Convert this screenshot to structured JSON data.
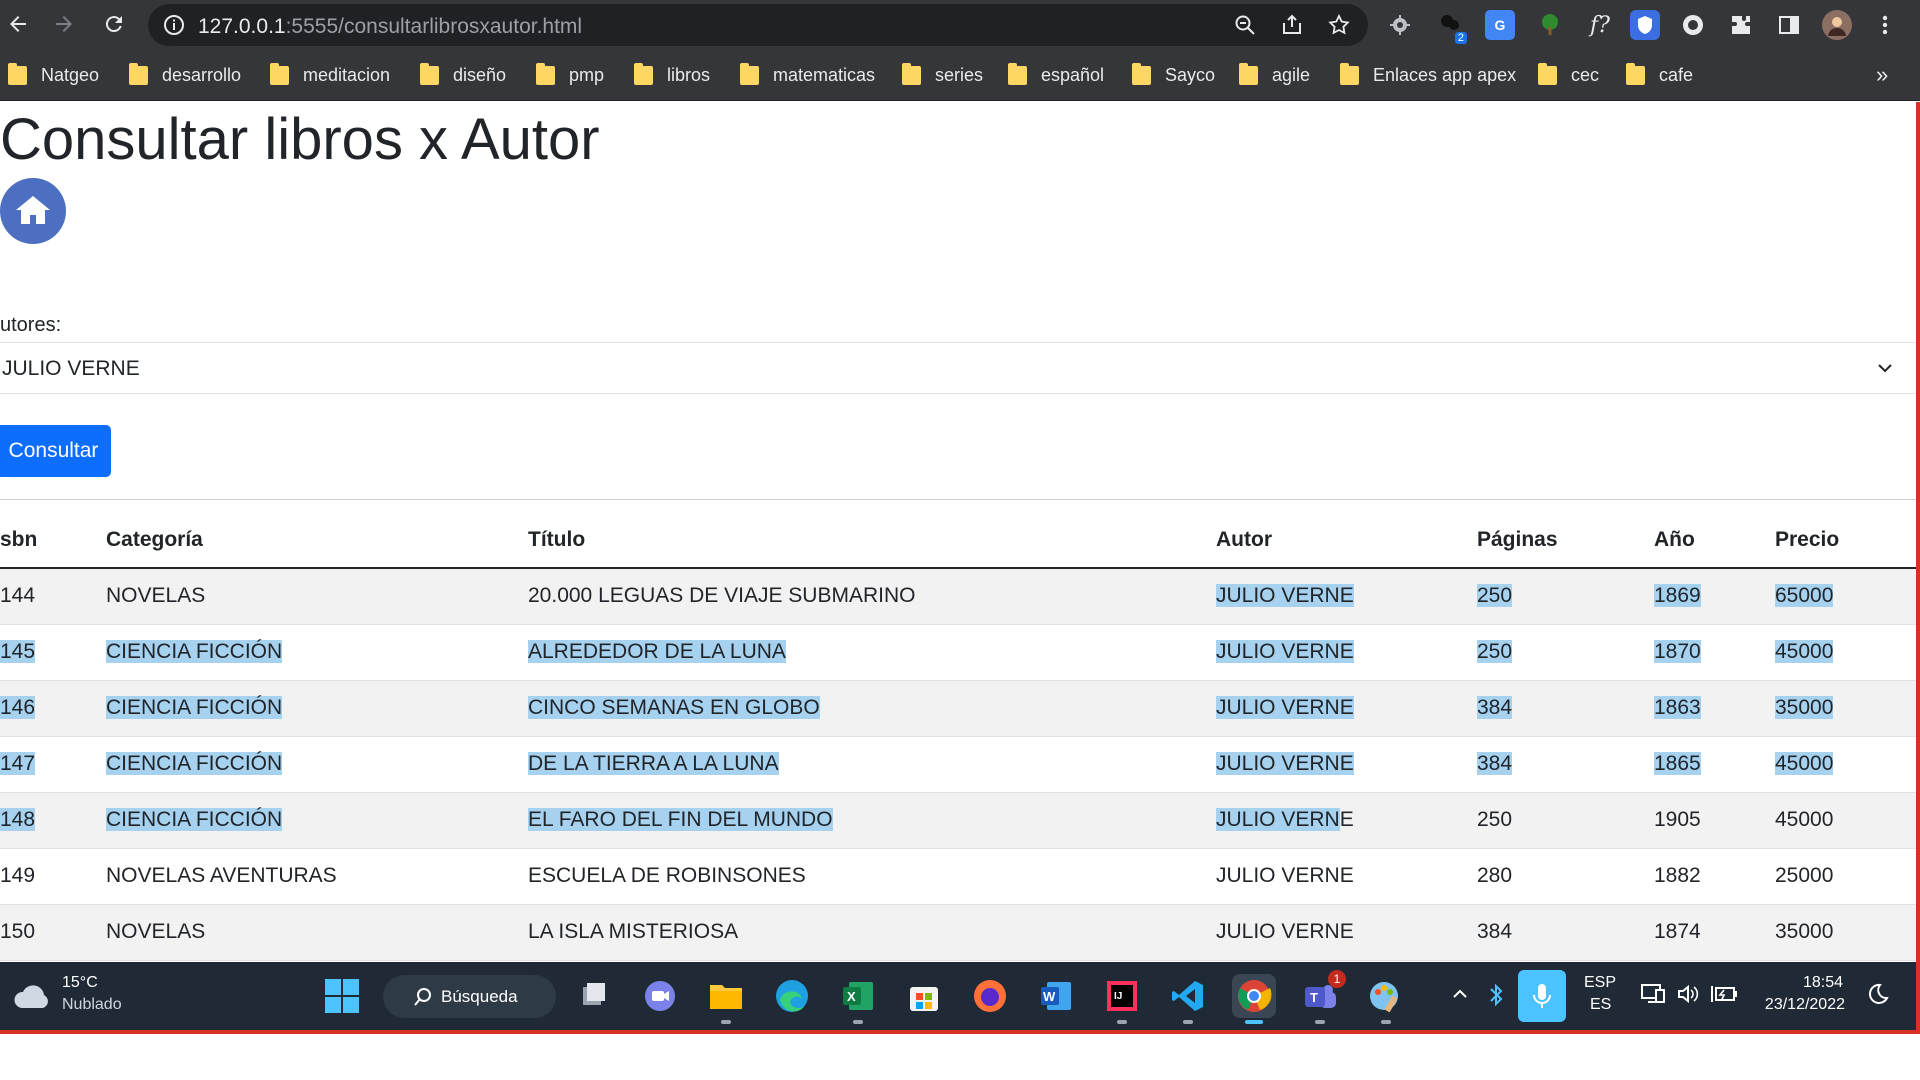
{
  "browser": {
    "url_host": "127.0.0.1",
    "url_path": ":5555/consultarlibrosxautor.html",
    "bookmarks": [
      "Natgeo",
      "desarrollo",
      "meditacion",
      "diseño",
      "pmp",
      "libros",
      "matematicas",
      "series",
      "español",
      "Sayco",
      "agile",
      "Enlaces app apex",
      "cec",
      "cafe"
    ],
    "bookmarks_overflow": "»",
    "extension_badge": "2"
  },
  "page": {
    "title": "Consultar libros x Autor",
    "author_label": "utores:",
    "author_selected": "JULIO VERNE",
    "consult_button": "Consultar"
  },
  "table": {
    "headers": [
      "sbn",
      "Categoría",
      "Título",
      "Autor",
      "Páginas",
      "Año",
      "Precio"
    ],
    "rows": [
      {
        "isbn": "144",
        "categoria": "NOVELAS",
        "titulo": "20.000 LEGUAS DE VIAJE SUBMARINO",
        "autor": "JULIO VERNE",
        "paginas": "250",
        "ano": "1869",
        "precio": "65000"
      },
      {
        "isbn": "145",
        "categoria": "CIENCIA FICCIÓN",
        "titulo": "ALREDEDOR DE LA LUNA",
        "autor": "JULIO VERNE",
        "paginas": "250",
        "ano": "1870",
        "precio": "45000"
      },
      {
        "isbn": "146",
        "categoria": "CIENCIA FICCIÓN",
        "titulo": "CINCO SEMANAS EN GLOBO",
        "autor": "JULIO VERNE",
        "paginas": "384",
        "ano": "1863",
        "precio": "35000"
      },
      {
        "isbn": "147",
        "categoria": "CIENCIA FICCIÓN",
        "titulo": "DE LA TIERRA A LA LUNA",
        "autor": "JULIO VERNE",
        "paginas": "384",
        "ano": "1865",
        "precio": "45000"
      },
      {
        "isbn": "148",
        "categoria": "CIENCIA FICCIÓN",
        "titulo": "EL FARO DEL FIN DEL MUNDO",
        "autor_sel": "JULIO VERN",
        "autor_rest": "E",
        "paginas": "250",
        "ano": "1905",
        "precio": "45000"
      },
      {
        "isbn": "149",
        "categoria": "NOVELAS AVENTURAS",
        "titulo": "ESCUELA DE ROBINSONES",
        "autor": "JULIO VERNE",
        "paginas": "280",
        "ano": "1882",
        "precio": "25000"
      },
      {
        "isbn": "150",
        "categoria": "NOVELAS",
        "titulo": "LA ISLA MISTERIOSA",
        "autor": "JULIO VERNE",
        "paginas": "384",
        "ano": "1874",
        "precio": "35000"
      }
    ]
  },
  "taskbar": {
    "weather_temp": "15°C",
    "weather_desc": "Nublado",
    "search_label": "Búsqueda",
    "teams_badge": "1",
    "lang_top": "ESP",
    "lang_bottom": "ES",
    "time": "18:54",
    "date": "23/12/2022"
  },
  "colors": {
    "chrome_bg": "#35363a",
    "button_primary": "#0d6efd",
    "selection": "#a6d2f0",
    "taskbar_bg": "#202a36",
    "window_border": "#d93025"
  }
}
